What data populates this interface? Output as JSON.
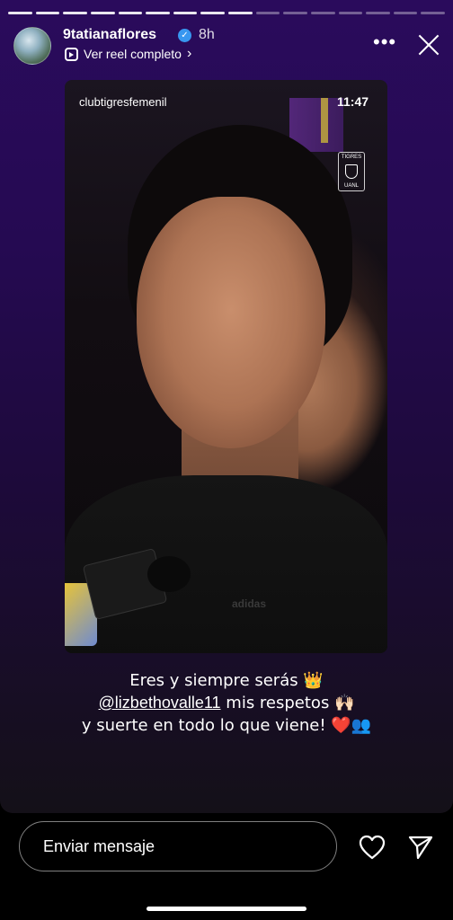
{
  "story": {
    "progress_total": 16,
    "progress_done": 9,
    "username": "9tatianaflores",
    "time_ago": "8h",
    "reel_link_label": "Ver reel completo",
    "reel_link_chevron": "›",
    "more_label": "•••"
  },
  "reel": {
    "account": "clubtigresfemenil",
    "time": "11:47",
    "logo_text_top": "TIGRES",
    "logo_text_bottom": "UANL",
    "shirt_brand": "adidas"
  },
  "caption": {
    "line1": "Eres y siempre serás 👑",
    "line2_mention": "@lizbethovalle11",
    "line2_rest": " mis respetos 🙌🏻",
    "line3": "y suerte en todo lo que viene! ❤️👥"
  },
  "footer": {
    "message_placeholder": "Enviar mensaje",
    "like_icon": "heart-icon",
    "send_icon": "paper-plane-icon"
  },
  "colors": {
    "story_gradient_top": "#2a0b5c",
    "verified_blue": "#3897f0",
    "background": "#000000"
  }
}
